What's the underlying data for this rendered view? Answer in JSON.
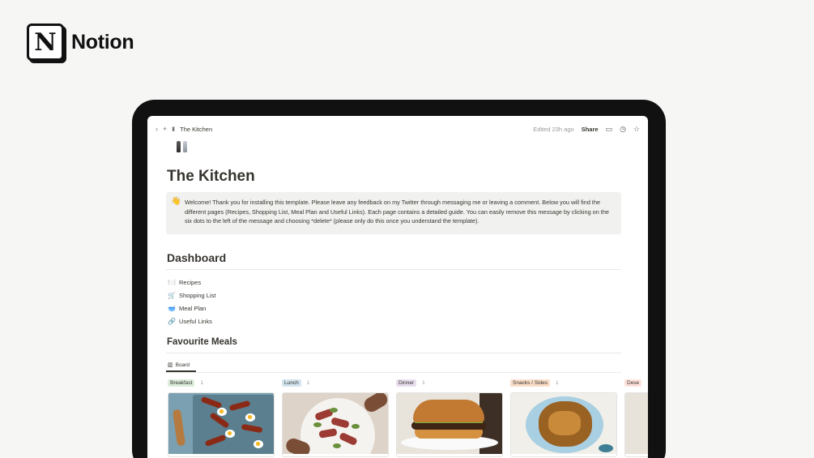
{
  "brand": {
    "name": "Notion",
    "mark": "N"
  },
  "topbar": {
    "breadcrumb_title": "The Kitchen",
    "edited": "Edited 23h ago",
    "share_label": "Share"
  },
  "page": {
    "title": "The Kitchen",
    "callout": {
      "emoji": "👋",
      "text": "Welcome! Thank you for installing this template. Please leave any feedback on my Twitter through messaging me or leaving a comment. Below you will find the different pages (Recipes, Shopping List, Meal Plan and Useful Links). Each page contains a detailed guide. You can easily remove this message by clicking on the six dots to the left of the message and choosing *delete* (please only do this once you understand the template)."
    },
    "dashboard": {
      "heading": "Dashboard",
      "items": [
        {
          "emoji": "🍽️",
          "label": "Recipes"
        },
        {
          "emoji": "🛒",
          "label": "Shopping List"
        },
        {
          "emoji": "🥣",
          "label": "Meal Plan"
        },
        {
          "emoji": "🔗",
          "label": "Useful Links"
        }
      ]
    },
    "favourites": {
      "heading": "Favourite Meals",
      "view_label": "Board",
      "columns": [
        {
          "label": "Breakfast",
          "count": "1",
          "color": "#dbeddb"
        },
        {
          "label": "Lunch",
          "count": "1",
          "color": "#d3e5ef"
        },
        {
          "label": "Dinner",
          "count": "1",
          "color": "#e8deee"
        },
        {
          "label": "Snacks / Sides",
          "count": "1",
          "color": "#fadec9"
        },
        {
          "label": "Dese",
          "count": "",
          "color": "#ffe2dd"
        }
      ]
    }
  },
  "colors": {
    "background": "#f6f6f5",
    "text": "#37352f",
    "muted": "#9b9a97",
    "callout_bg": "#f1f1ef"
  }
}
